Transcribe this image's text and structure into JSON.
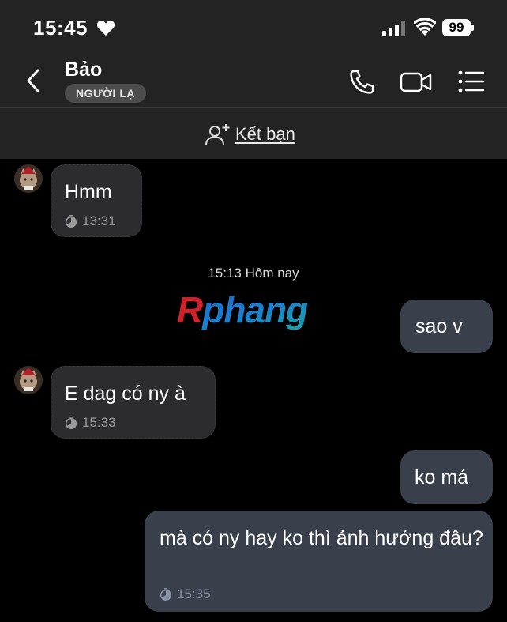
{
  "status_bar": {
    "time": "15:45",
    "battery": "99"
  },
  "header": {
    "contact_name": "Bảo",
    "badge": "NGƯỜI LẠ"
  },
  "add_friend": {
    "label": "Kết bạn"
  },
  "messages": [
    {
      "direction": "in",
      "text": "Hmm",
      "time": "13:31"
    },
    {
      "direction": "out",
      "text": "sao v"
    },
    {
      "direction": "in",
      "text": "E dag có ny à",
      "time": "15:33"
    },
    {
      "direction": "out",
      "text": "ko má"
    },
    {
      "direction": "out",
      "text": "mà có ny hay ko thì ảnh hưởng đâu?",
      "time": "15:35"
    }
  ],
  "date_divider": "15:13 Hôm nay",
  "watermark": "Rphang",
  "colors": {
    "background": "#000000",
    "header": "#232323",
    "bubble_in": "#2c2c2e",
    "bubble_out": "#3a404b",
    "watermark_red": "#d2202a",
    "watermark_blue": "#1e6fd9"
  }
}
